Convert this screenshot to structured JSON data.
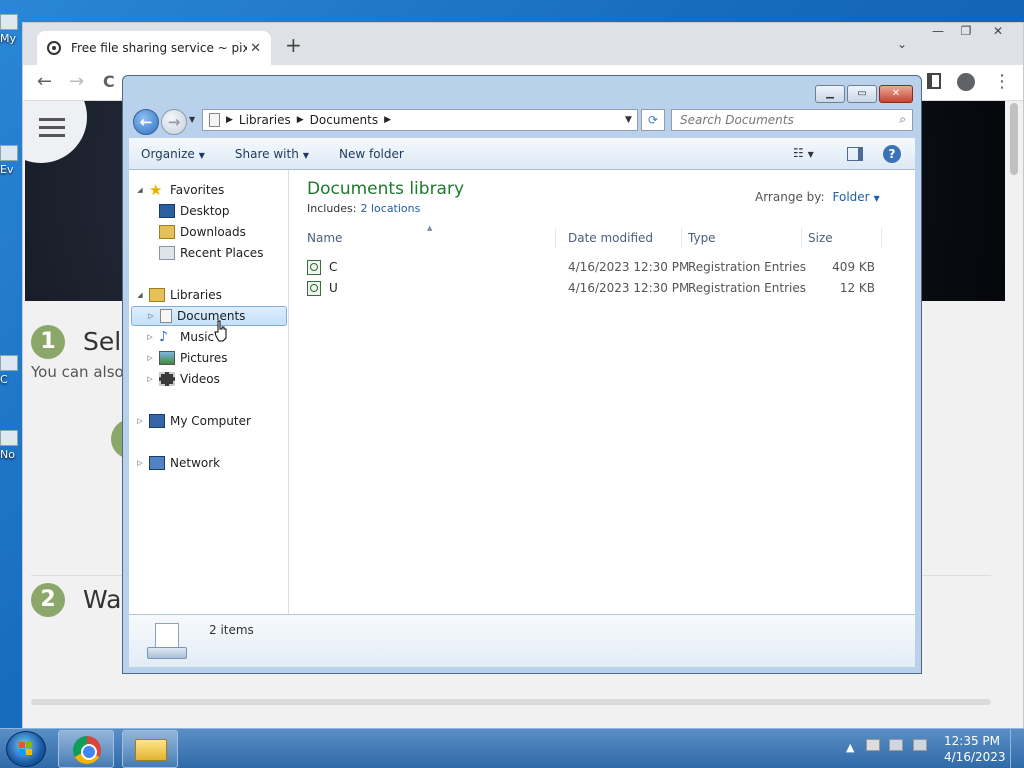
{
  "desktop": {
    "icons": [
      {
        "label": "My"
      },
      {
        "label": "Ev"
      },
      {
        "label": "C"
      },
      {
        "label": "No"
      }
    ]
  },
  "browser": {
    "tab_title": "Free file sharing service ~ pixeldrain",
    "tab_close": "✕",
    "new_tab": "+",
    "tab_menu": "⌄",
    "win_min": "—",
    "win_max": "❐",
    "win_close": "✕",
    "back": "←",
    "forward": "→",
    "reload": "C",
    "menu_dots": "⋮"
  },
  "page": {
    "step1_num": "1",
    "step1_title": "Sele",
    "step1_sub": "You can also",
    "step2_num": "2",
    "step2_title": "Wai"
  },
  "explorer": {
    "breadcrumb": [
      "Libraries",
      "Documents"
    ],
    "search_placeholder": "Search Documents",
    "commands": {
      "organize": "Organize",
      "share": "Share with",
      "new_folder": "New folder"
    },
    "help": "?",
    "nav": {
      "favorites": "Favorites",
      "desktop": "Desktop",
      "downloads": "Downloads",
      "recent": "Recent Places",
      "libraries": "Libraries",
      "documents": "Documents",
      "music": "Music",
      "pictures": "Pictures",
      "videos": "Videos",
      "computer": "My Computer",
      "network": "Network"
    },
    "library_title": "Documents library",
    "includes_label": "Includes:",
    "includes_link": "2 locations",
    "arrange_label": "Arrange by:",
    "arrange_value": "Folder",
    "columns": {
      "name": "Name",
      "date": "Date modified",
      "type": "Type",
      "size": "Size"
    },
    "files": [
      {
        "name": "C",
        "date": "4/16/2023 12:30 PM",
        "type": "Registration Entries",
        "size": "409 KB"
      },
      {
        "name": "U",
        "date": "4/16/2023 12:30 PM",
        "type": "Registration Entries",
        "size": "12 KB"
      }
    ],
    "status_count": "2 items"
  },
  "taskbar": {
    "time": "12:35 PM",
    "date": "4/16/2023",
    "tray_arrow": "▲"
  },
  "colors": {
    "library_title": "#1e7a2e",
    "link": "#1d5fa8",
    "taskbar": "#2f6aa8"
  }
}
